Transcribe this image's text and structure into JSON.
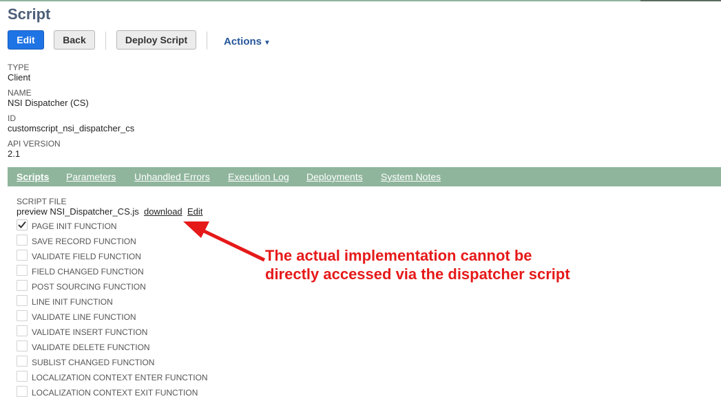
{
  "page": {
    "title": "Script"
  },
  "toolbar": {
    "edit_label": "Edit",
    "back_label": "Back",
    "deploy_label": "Deploy Script",
    "actions_label": "Actions"
  },
  "fields": [
    {
      "label": "TYPE",
      "value": "Client"
    },
    {
      "label": "NAME",
      "value": "NSI Dispatcher (CS)"
    },
    {
      "label": "ID",
      "value": "customscript_nsi_dispatcher_cs"
    },
    {
      "label": "API VERSION",
      "value": "2.1"
    }
  ],
  "tabs": [
    {
      "label": "Scripts",
      "active": true
    },
    {
      "label": "Parameters"
    },
    {
      "label": "Unhandled Errors"
    },
    {
      "label": "Execution Log"
    },
    {
      "label": "Deployments"
    },
    {
      "label": "System Notes"
    }
  ],
  "scripts_tab": {
    "script_file_label": "SCRIPT FILE",
    "preview_text": "preview NSI_Dispatcher_CS.js",
    "download_label": "download",
    "edit_label": "Edit",
    "functions": [
      {
        "label": "PAGE INIT FUNCTION",
        "checked": true
      },
      {
        "label": "SAVE RECORD FUNCTION",
        "checked": false
      },
      {
        "label": "VALIDATE FIELD FUNCTION",
        "checked": false
      },
      {
        "label": "FIELD CHANGED FUNCTION",
        "checked": false
      },
      {
        "label": "POST SOURCING FUNCTION",
        "checked": false
      },
      {
        "label": "LINE INIT FUNCTION",
        "checked": false
      },
      {
        "label": "VALIDATE LINE FUNCTION",
        "checked": false
      },
      {
        "label": "VALIDATE INSERT FUNCTION",
        "checked": false
      },
      {
        "label": "VALIDATE DELETE FUNCTION",
        "checked": false
      },
      {
        "label": "SUBLIST CHANGED FUNCTION",
        "checked": false
      },
      {
        "label": "LOCALIZATION CONTEXT ENTER FUNCTION",
        "checked": false
      },
      {
        "label": "LOCALIZATION CONTEXT EXIT FUNCTION",
        "checked": false
      }
    ]
  },
  "annotation": {
    "line1": "The actual implementation cannot be",
    "line2": "directly accessed via the dispatcher script",
    "color": "#e61919"
  },
  "colors": {
    "accent_blue": "#1f74e5",
    "tab_bar_green": "#8fb59c",
    "title_color": "#4d5f79",
    "link_blue": "#255599"
  }
}
